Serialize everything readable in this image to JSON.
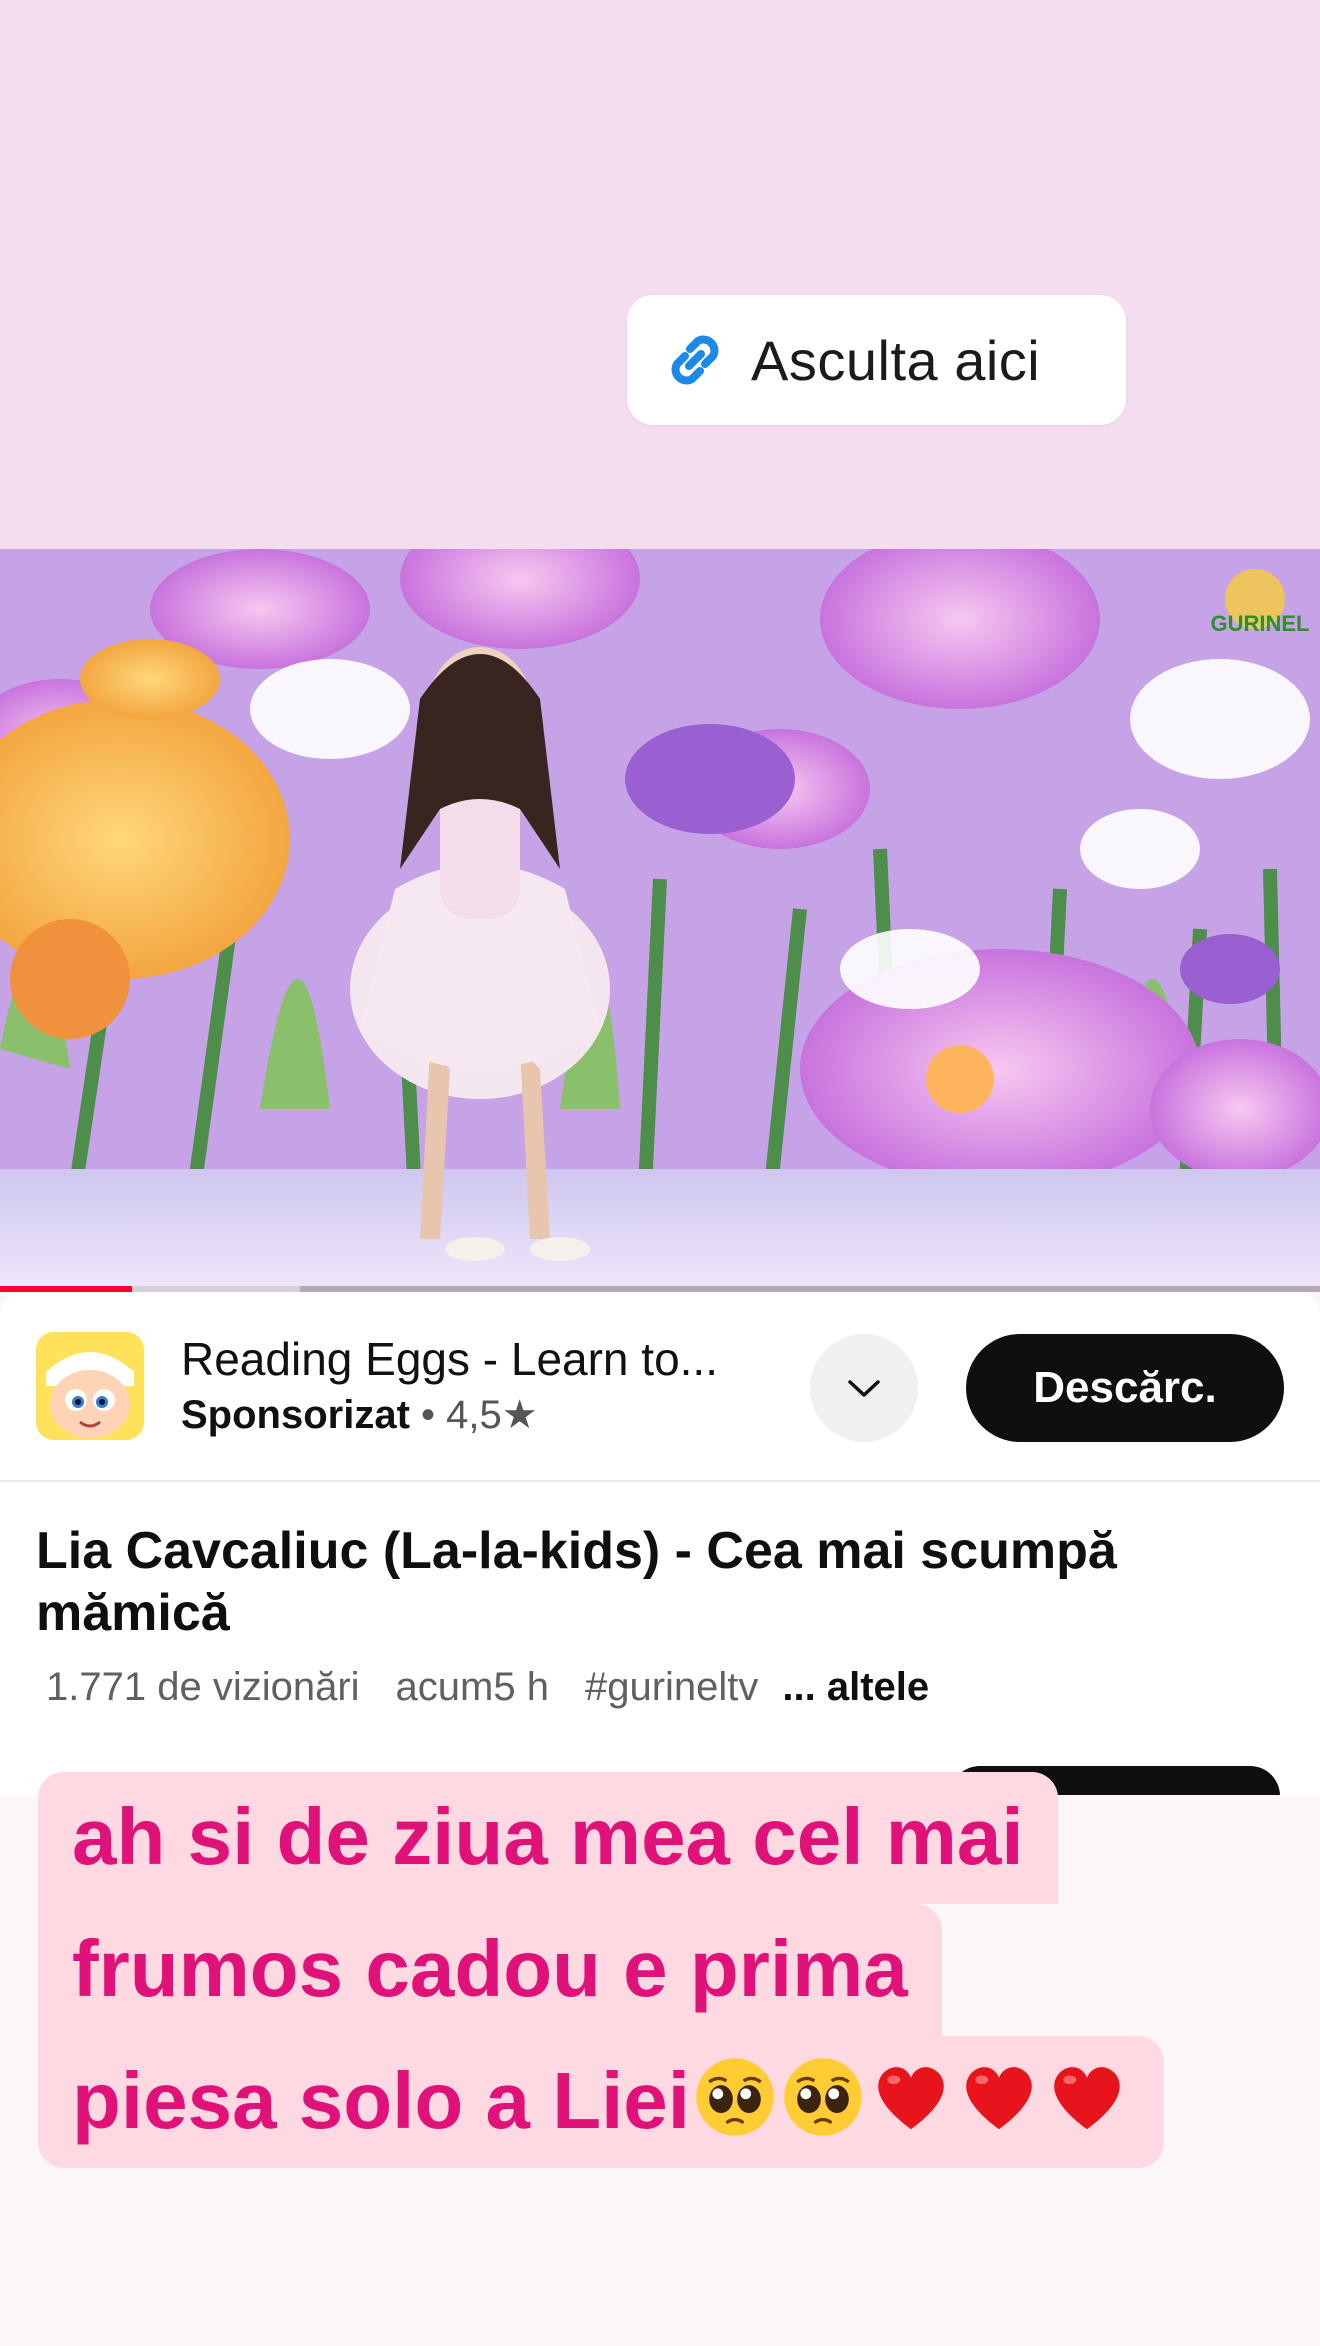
{
  "story": {
    "link_sticker": {
      "label": "Asculta aici",
      "icon": "link-icon"
    },
    "caption_lines": [
      "ah si de ziua mea cel mai",
      "frumos cadou e prima",
      "piesa solo a Liei"
    ],
    "caption_emojis": [
      "pleading-face",
      "pleading-face",
      "red-heart",
      "red-heart",
      "red-heart"
    ]
  },
  "video": {
    "channel_watermark": "GURINEL",
    "progress_fraction": 0.1
  },
  "ad": {
    "title": "Reading Eggs - Learn to...",
    "sponsored": "Sponsorizat",
    "separator": "•",
    "rating": "4,5★",
    "download_label": "Descărc."
  },
  "details": {
    "title": "Lia Cavcaliuc (La-la-kids) - Cea mai scumpă mămică",
    "views": "1.771 de vizionări",
    "time": "acum5 h",
    "hashtag": "#gurineltv",
    "more": "... altele"
  },
  "colors": {
    "story_bg": "#f4ddee",
    "caption_text": "#e0127a",
    "caption_bg": "#ffd9e2",
    "progress": "#ff0033",
    "link_icon": "#1a8ae6"
  }
}
